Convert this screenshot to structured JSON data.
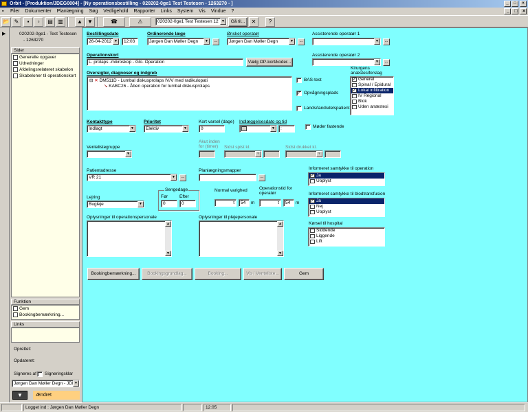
{
  "window": {
    "title": "Orbit - [Produktion/JDEG0004] - [Ny operationsbestilling - 020202-0ge1 Test Testesen - 1263270 - ]"
  },
  "menu": [
    "Filer",
    "Dokumenter",
    "Planlægning",
    "Søg",
    "Vedligehold",
    "Rapporter",
    "Links",
    "System",
    "Vis",
    "Vindue",
    "?"
  ],
  "toolbar": {
    "patient_combo": "020202-0ge1 Test Testesen 12",
    "goto_label": "Gå til..."
  },
  "sidebar": {
    "patient": "020202-0ge1 - Test Testesen",
    "patient_id": "- 1263270",
    "pages_header": "Sider",
    "pages": [
      "Generelle opgaver",
      "Udredninger",
      "Afdelingsrelateret skabelon",
      "Skabeloner til operationskort"
    ],
    "function_header": "Funktion",
    "functions": [
      "Gem",
      "Bookingbemærkning..."
    ],
    "links_header": "Links",
    "created_label": "Oprettet:",
    "updated_label": "Opdateret:",
    "signed_label": "Signeres af",
    "sign_clear_label": "Signeringsklar",
    "signer": "Jørgen Dan Møller Degn - JDI",
    "status": "Ændret"
  },
  "form": {
    "order_date_label": "Bestillingsdato",
    "order_date": "26-04-2012",
    "order_time": "12:03",
    "doctor_label": "Ordinerende læge",
    "doctor": "Jørgen Dan Møller Degn",
    "operator_label": "Ønsket operatør",
    "operator": "Jørgen Dan Møller Degn",
    "asst1_label": "Assisterende operatør 1",
    "asst1": "",
    "asst2_label": "Assisterende operatør 2",
    "asst2": "",
    "opcard_label": "Operationskort",
    "opcard": "L. prolaps -mikroskop - Glo. Operation",
    "opcard_button": "Vælg OP-kort/koder...",
    "overview_label": "Oversigter, diagnoser og indgreb",
    "tree": [
      {
        "code": "DM511D - Lumbal diskusprolaps IV/V med radikulopati"
      },
      {
        "code": "KABC26 - Åben operation for lumbal diskusprolaps"
      }
    ],
    "bas_label": "BAS-test",
    "wake_label": "Opvågningsplads",
    "region_label": "Lands/landsdelspatient",
    "anesth_label": "Kirurgens anæstesiforslag",
    "anesth_items": [
      "Generel",
      "Spinal / Epidural",
      "Lokal infiltration",
      "IV Regional",
      "Blok",
      "Uden anæstesi"
    ],
    "contact_label": "Kontakttype",
    "contact": "Indlagt",
    "priority_label": "Prioritet",
    "priority": "Elektiv",
    "short_notice_label": "Kort varsel (dage)",
    "short_notice": "0",
    "admission_label": "Indlæggelsesdato og tid",
    "admission_time": ":",
    "fasting_label": "Møder fastende",
    "waitlist_label": "Ventelistegruppe",
    "acute_label": "Akut inden for (timer)",
    "last_eat_label": "Sidst spist kl.",
    "last_drink_label": "Sidst drukket kl.",
    "address_label": "Patientadresse",
    "address": "VR 21",
    "planning_label": "Planlægningsmapper",
    "consent_op_label": "Informeret samtykke til operation",
    "consent_op": [
      "Ja",
      "Uoplyst"
    ],
    "bed_label": "Sengedage",
    "before_label": "Før",
    "after_label": "Efter",
    "before": "0",
    "after": "0",
    "position_label": "Lejring",
    "position": "Bugleje",
    "normal_dur_label": "Normal varighed",
    "normal_dur_h": "t",
    "normal_dur_m": "54",
    "m_label": "m",
    "op_time_label": "Operationstid for operatør",
    "op_time_h": "t",
    "op_time_m": "54",
    "consent_blood_label": "Informeret samtykke til blodtransfusion",
    "consent_blood": [
      "Ja",
      "Nej",
      "Uoplyst"
    ],
    "info_op_label": "Oplysninger til operationspersonale",
    "info_care_label": "Oplysninger til plejepersonale",
    "transport_label": "Kørsel til hospital",
    "transport": [
      "Siddende",
      "Liggende",
      "Lift"
    ]
  },
  "buttons": {
    "booking": "Bookingbemærkning...",
    "booking_basis": "Bookingsgrundlag...",
    "booking2": "Booking...",
    "waitlist": "Vis i Venteliste...",
    "save": "Gem"
  },
  "status": {
    "user": "Logget ind : Jørgen Dan Møller Degn",
    "time": "12:05"
  }
}
